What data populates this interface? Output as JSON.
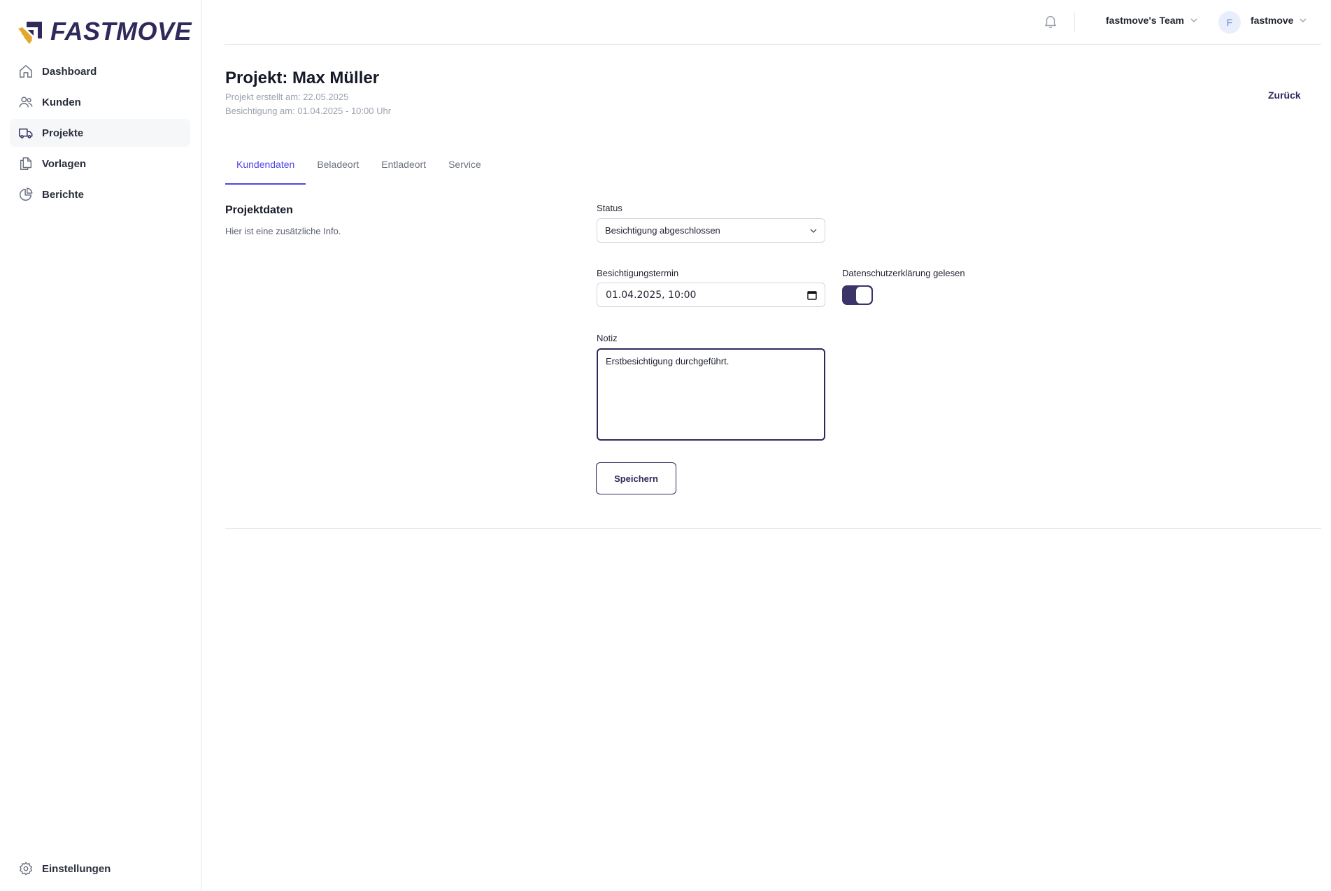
{
  "brand": {
    "name": "FASTMOVE",
    "accent": "#2f2a5c",
    "logo_gold": "#e0a92b"
  },
  "sidebar": {
    "items": [
      {
        "label": "Dashboard",
        "icon": "home-icon"
      },
      {
        "label": "Kunden",
        "icon": "users-icon"
      },
      {
        "label": "Projekte",
        "icon": "truck-icon",
        "active": true
      },
      {
        "label": "Vorlagen",
        "icon": "documents-icon"
      },
      {
        "label": "Berichte",
        "icon": "pie-chart-icon"
      }
    ],
    "settings_label": "Einstellungen"
  },
  "topbar": {
    "team_label": "fastmove's Team",
    "avatar_initial": "F",
    "user_label": "fastmove"
  },
  "header": {
    "title": "Projekt: Max Müller",
    "created": "Projekt erstellt am: 22.05.2025",
    "inspection": "Besichtigung am: 01.04.2025 - 10:00 Uhr",
    "back_label": "Zurück"
  },
  "tabs": [
    {
      "label": "Kundendaten",
      "active": true
    },
    {
      "label": "Beladeort"
    },
    {
      "label": "Entladeort"
    },
    {
      "label": "Service"
    }
  ],
  "section": {
    "title": "Projektdaten",
    "description": "Hier ist eine zusätzliche Info."
  },
  "form": {
    "status_label": "Status",
    "status_value": "Besichtigung abgeschlossen",
    "appointment_label": "Besichtigungstermin",
    "appointment_value": "01.04.2025, 10:00",
    "privacy_label": "Datenschutzerklärung gelesen",
    "privacy_checked": true,
    "note_label": "Notiz",
    "note_value": "Erstbesichtigung durchgeführt.",
    "save_label": "Speichern"
  }
}
